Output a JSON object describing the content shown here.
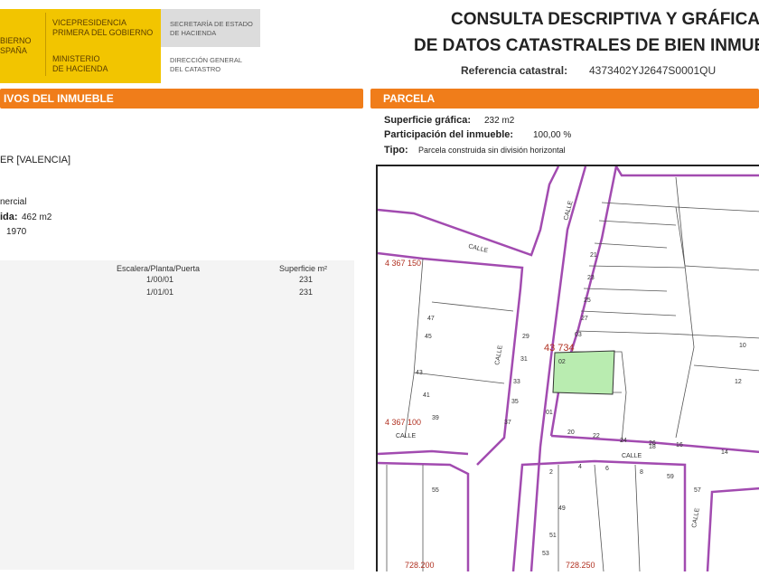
{
  "header": {
    "logo": {
      "line1": "VICEPRESIDENCIA",
      "line2": "PRIMERA DEL GOBIERNO",
      "line3": "MINISTERIO",
      "line4": "DE HACIENDA",
      "left1": "BIERNO",
      "left2": "SPAÑA",
      "sec1": "SECRETARÍA DE ESTADO",
      "sec2": "DE HACIENDA",
      "dir1": "DIRECCIÓN GENERAL",
      "dir2": "DEL CATASTRO"
    },
    "title_line1": "CONSULTA DESCRIPTIVA Y GRÁFICA",
    "title_line2": "DE DATOS CATASTRALES DE BIEN INMUE",
    "ref_label": "Referencia catastral:",
    "ref_value": "4373402YJ2647S0001QU"
  },
  "left": {
    "section_title": "IVOS DEL INMUEBLE",
    "location": "ER [VALENCIA]",
    "use": "nercial",
    "surface_label": "ida:",
    "surface_value": "462 m2",
    "year": "1970",
    "table": {
      "headers": [
        "Escalera/Planta/Puerta",
        "Superficie m²"
      ],
      "rows": [
        [
          "1/00/01",
          "231"
        ],
        [
          "1/01/01",
          "231"
        ]
      ]
    }
  },
  "right": {
    "section_title": "PARCELA",
    "superficie_label": "Superficie gráfica:",
    "superficie_value": "232 m2",
    "participacion_label": "Participación del inmueble:",
    "participacion_value": "100,00 %",
    "tipo_label": "Tipo:",
    "tipo_value": "Parcela construida sin división horizontal"
  },
  "map": {
    "parcel_color": "#b9ecb0",
    "street_color": "#a24bb0",
    "coord_color": "#b03020",
    "coords": [
      "4 367 150",
      "4 367 100",
      "728.200",
      "728.250",
      "43 734"
    ],
    "streets": [
      "CALLE",
      "CALLE",
      "CALLE",
      "CALLE",
      "CALLE",
      "CALLE"
    ],
    "parcel_numbers": [
      "03",
      "02",
      "01",
      "26",
      "24",
      "22",
      "20",
      "18",
      "16",
      "14",
      "12",
      "10",
      "8",
      "6",
      "4",
      "2",
      "21",
      "23",
      "25",
      "27",
      "29",
      "31",
      "33",
      "35",
      "37",
      "39",
      "41",
      "43",
      "45",
      "47",
      "49",
      "51",
      "53",
      "55",
      "57",
      "59"
    ]
  }
}
